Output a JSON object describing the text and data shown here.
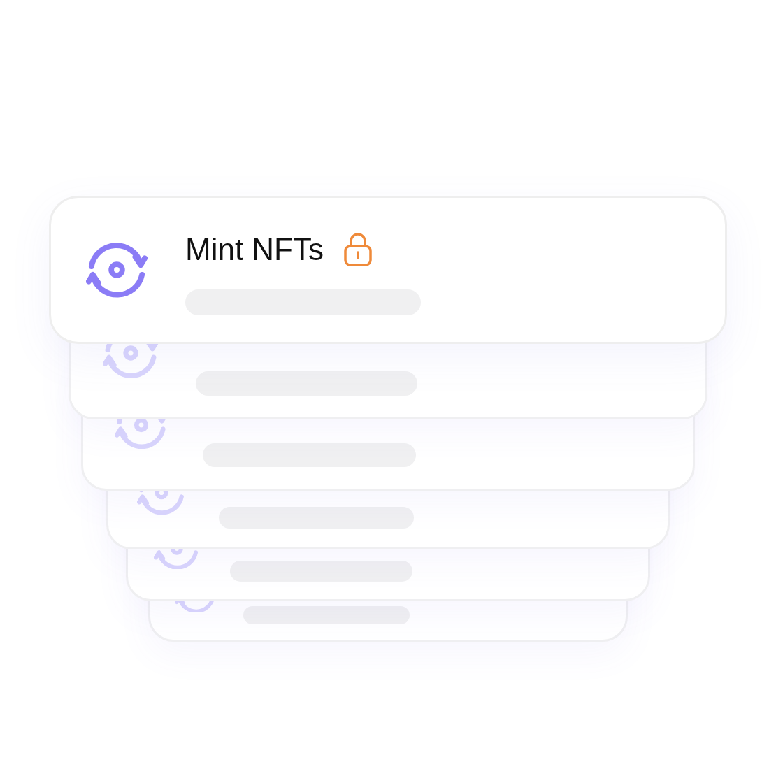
{
  "card": {
    "title": "Mint NFTs",
    "locked": true
  }
}
